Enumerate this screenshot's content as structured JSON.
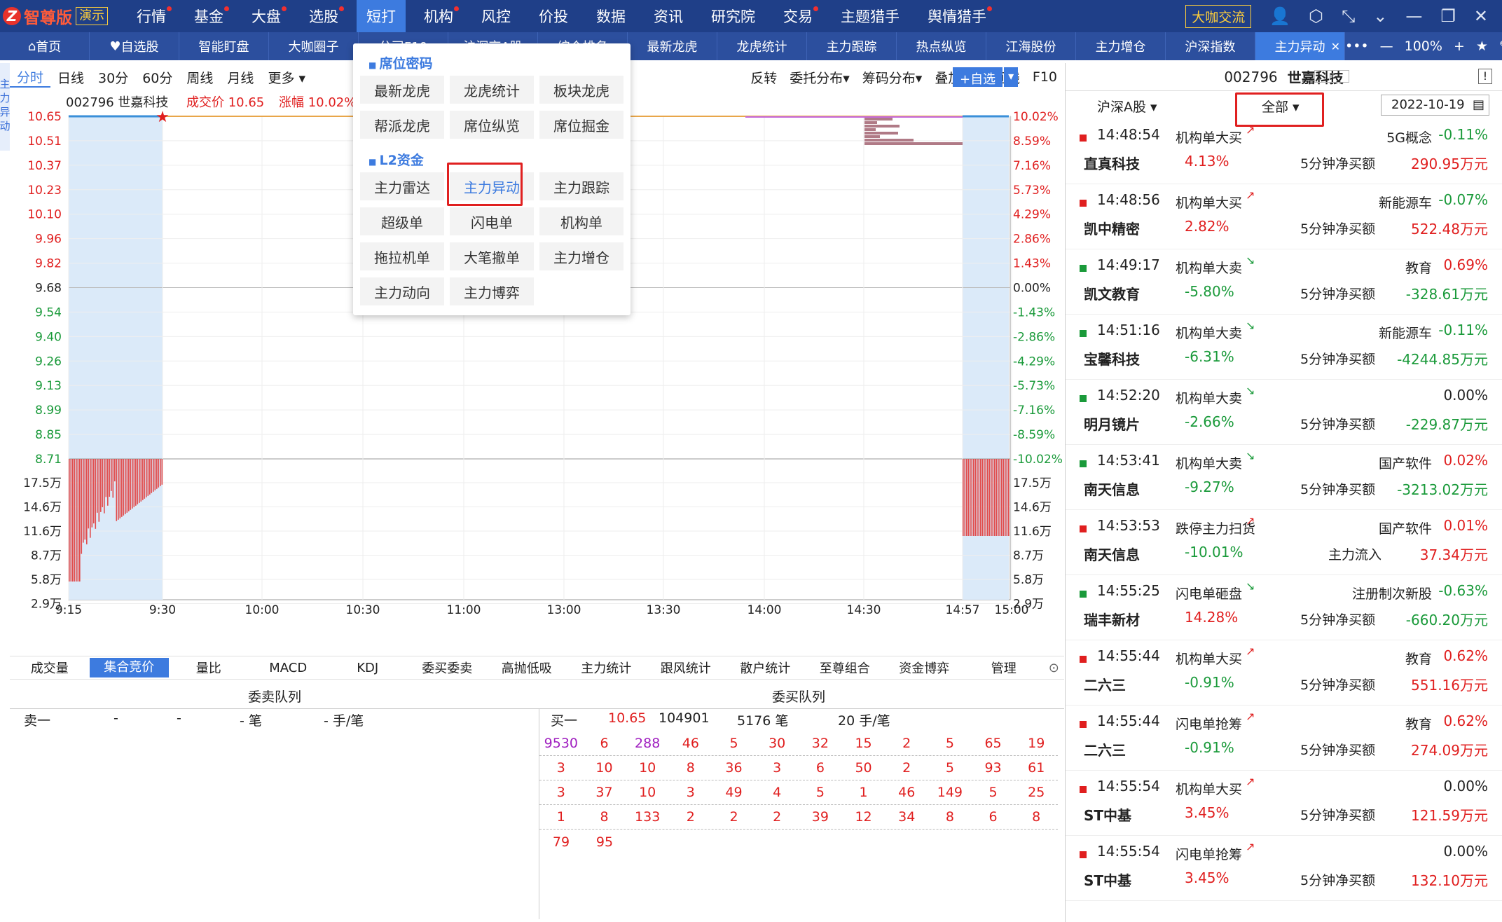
{
  "app": {
    "logo_text": "智尊版",
    "demo_badge": "演示"
  },
  "topnav": {
    "items": [
      {
        "label": "行情",
        "dot": true
      },
      {
        "label": "基金",
        "dot": true
      },
      {
        "label": "大盘",
        "dot": true
      },
      {
        "label": "选股",
        "dot": true
      },
      {
        "label": "短打",
        "dot": false
      },
      {
        "label": "机构",
        "dot": true
      },
      {
        "label": "风控",
        "dot": false
      },
      {
        "label": "价投",
        "dot": false
      },
      {
        "label": "数据",
        "dot": false
      },
      {
        "label": "资讯",
        "dot": false
      },
      {
        "label": "研究院",
        "dot": false
      },
      {
        "label": "交易",
        "dot": true
      },
      {
        "label": "主题猎手",
        "dot": false
      },
      {
        "label": "舆情猎手",
        "dot": true
      }
    ],
    "active_index": 4,
    "right_button": "大咖交流"
  },
  "tabs": {
    "items": [
      "首页",
      "自选股",
      "智能盯盘",
      "大咖圈子",
      "公司F10",
      "沪深京A股",
      "综合排名",
      "最新龙虎",
      "龙虎统计",
      "主力跟踪",
      "热点纵览",
      "江海股份",
      "主力增仓",
      "沪深指数",
      "主力异动"
    ],
    "active_index": 14,
    "zoom": "100%"
  },
  "left_strip": {
    "text": [
      "主",
      "力",
      "异",
      "动"
    ]
  },
  "period_toolbar": {
    "items": [
      "分时",
      "日线",
      "30分",
      "60分",
      "周线",
      "月线",
      "更多 ▾"
    ],
    "right_items": [
      "反转",
      "委托分布▾",
      "筹码分布▾",
      "叠加",
      "▾",
      "画线",
      "F10"
    ],
    "add_label": "+自选"
  },
  "chart": {
    "header": {
      "code_name": "002796 世嘉科技",
      "price_label": "成交价 10.65",
      "change_label": "涨幅 10.02%"
    },
    "price_left": [
      "10.65",
      "10.51",
      "10.37",
      "10.23",
      "10.10",
      "9.96",
      "9.82",
      "9.68",
      "9.54",
      "9.40",
      "9.26",
      "9.13",
      "8.99",
      "8.85",
      "8.71"
    ],
    "price_right": [
      "10.02%",
      "8.59%",
      "7.16%",
      "5.73%",
      "4.29%",
      "2.86%",
      "1.43%",
      "0.00%",
      "-1.43%",
      "-2.86%",
      "-4.29%",
      "-5.73%",
      "-7.16%",
      "-8.59%",
      "-10.02%"
    ],
    "vol_ticks": [
      "17.5万",
      "14.6万",
      "11.6万",
      "8.7万",
      "5.8万",
      "2.9万"
    ],
    "time_ticks": [
      "9:15",
      "9:30",
      "10:00",
      "10:30",
      "11:00",
      "13:00",
      "13:30",
      "14:00",
      "14:30",
      "14:57",
      "15:00"
    ]
  },
  "chart_data": {
    "type": "line",
    "title": "002796 世嘉科技",
    "y_range": [
      8.71,
      10.65
    ],
    "pct_range": [
      -10.02,
      10.02
    ],
    "last_price": 10.65,
    "change_pct": 10.02,
    "volume_range_wan": [
      0,
      17.5
    ]
  },
  "lower_tabs": {
    "items": [
      "成交量",
      "集合竞价",
      "量比",
      "MACD",
      "KDJ",
      "委买委卖",
      "高抛低吸",
      "主力统计",
      "跟风统计",
      "散户统计",
      "至尊组合",
      "资金博弈",
      "管理"
    ],
    "active_index": 1
  },
  "queue": {
    "sell_title": "委卖队列",
    "buy_title": "委买队列",
    "sell_row": {
      "label": "卖一",
      "v1": "-",
      "v2": "-",
      "v3": "- 笔",
      "v4": "- 手/笔"
    },
    "buy_row": {
      "label": "买一",
      "price": "10.65",
      "volume": "104901",
      "count": "5176 笔",
      "avg": "20 手/笔"
    },
    "buy_grid": [
      [
        "9530",
        "6",
        "288",
        "46",
        "5",
        "30",
        "32",
        "15",
        "2",
        "5",
        "65",
        "19"
      ],
      [
        "3",
        "10",
        "10",
        "8",
        "36",
        "3",
        "6",
        "50",
        "2",
        "5",
        "93",
        "61"
      ],
      [
        "3",
        "37",
        "10",
        "3",
        "49",
        "4",
        "5",
        "1",
        "46",
        "149",
        "5",
        "25"
      ],
      [
        "1",
        "8",
        "133",
        "2",
        "2",
        "2",
        "39",
        "12",
        "34",
        "8",
        "6",
        "8"
      ],
      [
        "79",
        "95"
      ]
    ]
  },
  "right_panel": {
    "code": "002796",
    "name": "世嘉科技",
    "badge": "R",
    "market": "沪深A股 ▾",
    "filter": "全部 ▾",
    "date": "2022-10-19",
    "items": [
      {
        "time": "14:48:54",
        "type": "机构单大买",
        "dir": "up",
        "concept": "5G概念",
        "concept_pct": "-0.11%",
        "stock": "直真科技",
        "pct": "4.13%",
        "metric": "5分钟净买额",
        "amount": "290.95万元"
      },
      {
        "time": "14:48:56",
        "type": "机构单大买",
        "dir": "up",
        "concept": "新能源车",
        "concept_pct": "-0.07%",
        "stock": "凯中精密",
        "pct": "2.82%",
        "metric": "5分钟净买额",
        "amount": "522.48万元"
      },
      {
        "time": "14:49:17",
        "type": "机构单大卖",
        "dir": "down",
        "concept": "教育",
        "concept_pct": "0.69%",
        "stock": "凯文教育",
        "pct": "-5.80%",
        "metric": "5分钟净买额",
        "amount": "-328.61万元"
      },
      {
        "time": "14:51:16",
        "type": "机构单大卖",
        "dir": "down",
        "concept": "新能源车",
        "concept_pct": "-0.11%",
        "stock": "宝馨科技",
        "pct": "-6.31%",
        "metric": "5分钟净买额",
        "amount": "-4244.85万元"
      },
      {
        "time": "14:52:20",
        "type": "机构单大卖",
        "dir": "down",
        "concept": "",
        "concept_pct": "0.00%",
        "stock": "明月镜片",
        "pct": "-2.66%",
        "metric": "5分钟净买额",
        "amount": "-229.87万元"
      },
      {
        "time": "14:53:41",
        "type": "机构单大卖",
        "dir": "down",
        "concept": "国产软件",
        "concept_pct": "0.02%",
        "stock": "南天信息",
        "pct": "-9.27%",
        "metric": "5分钟净买额",
        "amount": "-3213.02万元"
      },
      {
        "time": "14:53:53",
        "type": "跌停主力扫货",
        "dir": "up",
        "concept": "国产软件",
        "concept_pct": "0.01%",
        "stock": "南天信息",
        "pct": "-10.01%",
        "metric": "主力流入",
        "amount": "37.34万元"
      },
      {
        "time": "14:55:25",
        "type": "闪电单砸盘",
        "dir": "down",
        "concept": "注册制次新股",
        "concept_pct": "-0.63%",
        "stock": "瑞丰新材",
        "pct": "14.28%",
        "metric": "5分钟净买额",
        "amount": "-660.20万元"
      },
      {
        "time": "14:55:44",
        "type": "机构单大买",
        "dir": "up",
        "concept": "教育",
        "concept_pct": "0.62%",
        "stock": "二六三",
        "pct": "-0.91%",
        "metric": "5分钟净买额",
        "amount": "551.16万元"
      },
      {
        "time": "14:55:44",
        "type": "闪电单抢筹",
        "dir": "up",
        "concept": "教育",
        "concept_pct": "0.62%",
        "stock": "二六三",
        "pct": "-0.91%",
        "metric": "5分钟净买额",
        "amount": "274.09万元"
      },
      {
        "time": "14:55:54",
        "type": "机构单大买",
        "dir": "up",
        "concept": "",
        "concept_pct": "0.00%",
        "stock": "ST中基",
        "pct": "3.45%",
        "metric": "5分钟净买额",
        "amount": "121.59万元"
      },
      {
        "time": "14:55:54",
        "type": "闪电单抢筹",
        "dir": "up",
        "concept": "",
        "concept_pct": "0.00%",
        "stock": "ST中基",
        "pct": "3.45%",
        "metric": "5分钟净买额",
        "amount": "132.10万元"
      }
    ]
  },
  "dropdown": {
    "section1": "席位密码",
    "section1_items": [
      "最新龙虎",
      "龙虎统计",
      "板块龙虎",
      "帮派龙虎",
      "席位纵览",
      "席位掘金"
    ],
    "section2": "L2资金",
    "section2_items": [
      "主力雷达",
      "主力异动",
      "主力跟踪",
      "超级单",
      "闪电单",
      "机构单",
      "拖拉机单",
      "大笔撤单",
      "主力增仓",
      "主力动向",
      "主力博弈"
    ],
    "highlight": "主力异动"
  },
  "colors": {
    "nav_bg": "#1f3f88",
    "tab_bg": "#2c4f9e",
    "accent": "#3d7bdf",
    "up": "#e01f1f",
    "down": "#1a9a3a",
    "highlight_box": "#e02020"
  }
}
